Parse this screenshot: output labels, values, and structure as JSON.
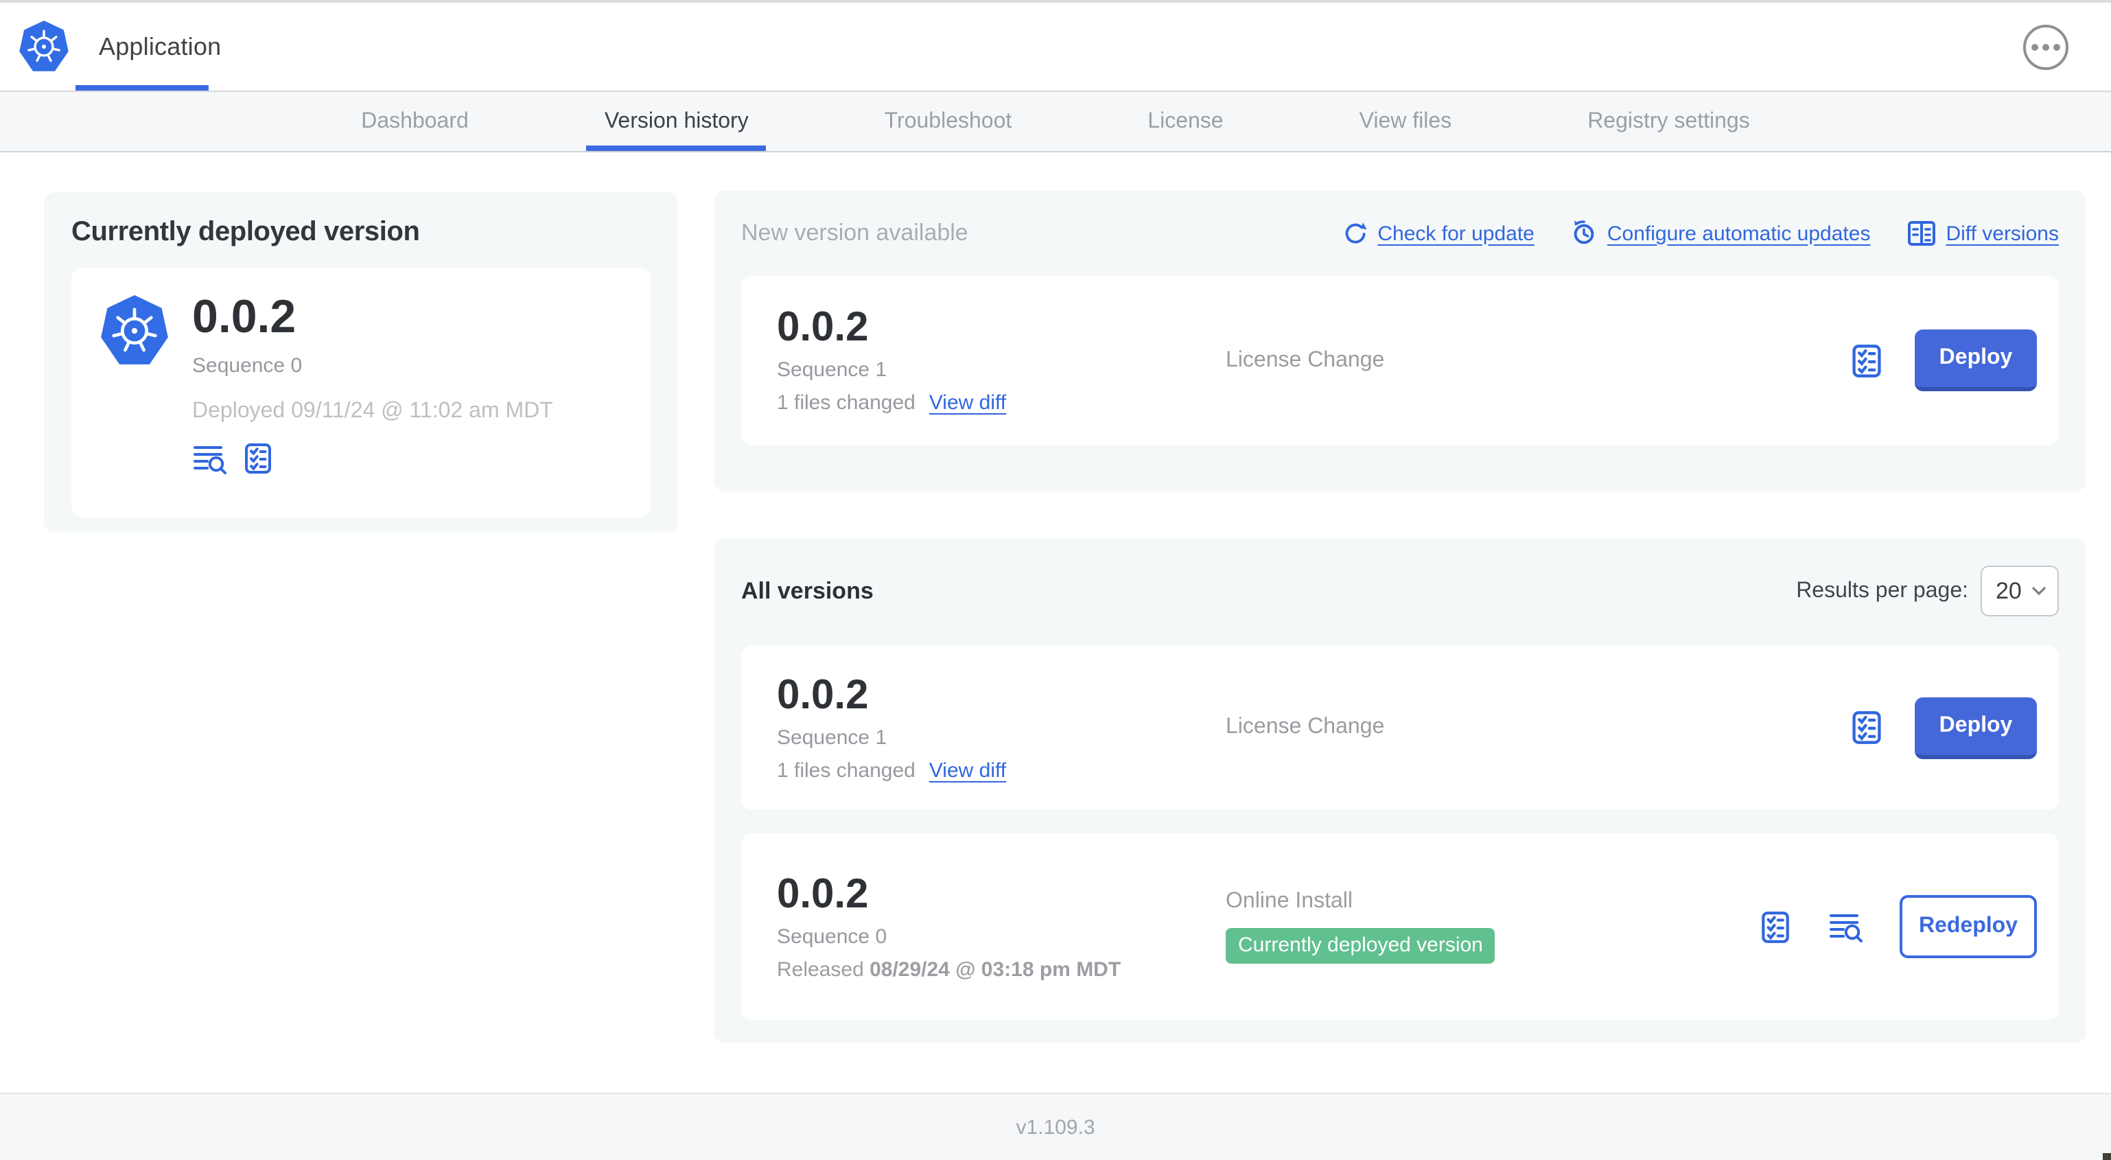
{
  "colors": {
    "accent_blue": "#3066de",
    "button_blue": "#4468d9",
    "badge_green": "#61c08f",
    "k8s_blue": "#326de6"
  },
  "header": {
    "app_tab": "Application"
  },
  "nav": {
    "tabs": [
      {
        "label": "Dashboard",
        "active": false
      },
      {
        "label": "Version history",
        "active": true
      },
      {
        "label": "Troubleshoot",
        "active": false
      },
      {
        "label": "License",
        "active": false
      },
      {
        "label": "View files",
        "active": false
      },
      {
        "label": "Registry settings",
        "active": false
      }
    ]
  },
  "current_version": {
    "title": "Currently deployed version",
    "version": "0.0.2",
    "sequence": "Sequence 0",
    "deployed": "Deployed 09/11/24 @ 11:02 am MDT"
  },
  "new_version": {
    "label": "New version available",
    "links": {
      "check": "Check for update",
      "configure": "Configure automatic updates",
      "diff": "Diff versions"
    },
    "card": {
      "version": "0.0.2",
      "sequence": "Sequence 1",
      "files_changed": "1 files changed",
      "view_diff": "View diff",
      "source": "License Change",
      "action": "Deploy"
    }
  },
  "all_versions": {
    "title": "All versions",
    "results_label": "Results per page:",
    "results_value": "20",
    "rows": [
      {
        "version": "0.0.2",
        "sequence": "Sequence 1",
        "files_changed": "1 files changed",
        "view_diff": "View diff",
        "source": "License Change",
        "action": "Deploy"
      },
      {
        "version": "0.0.2",
        "sequence": "Sequence 0",
        "released_prefix": "Released ",
        "released_date": "08/29/24 @ 03:18 pm MDT",
        "source": "Online Install",
        "badge": "Currently deployed version",
        "action": "Redeploy"
      }
    ]
  },
  "footer": {
    "console_version": "v1.109.3"
  }
}
